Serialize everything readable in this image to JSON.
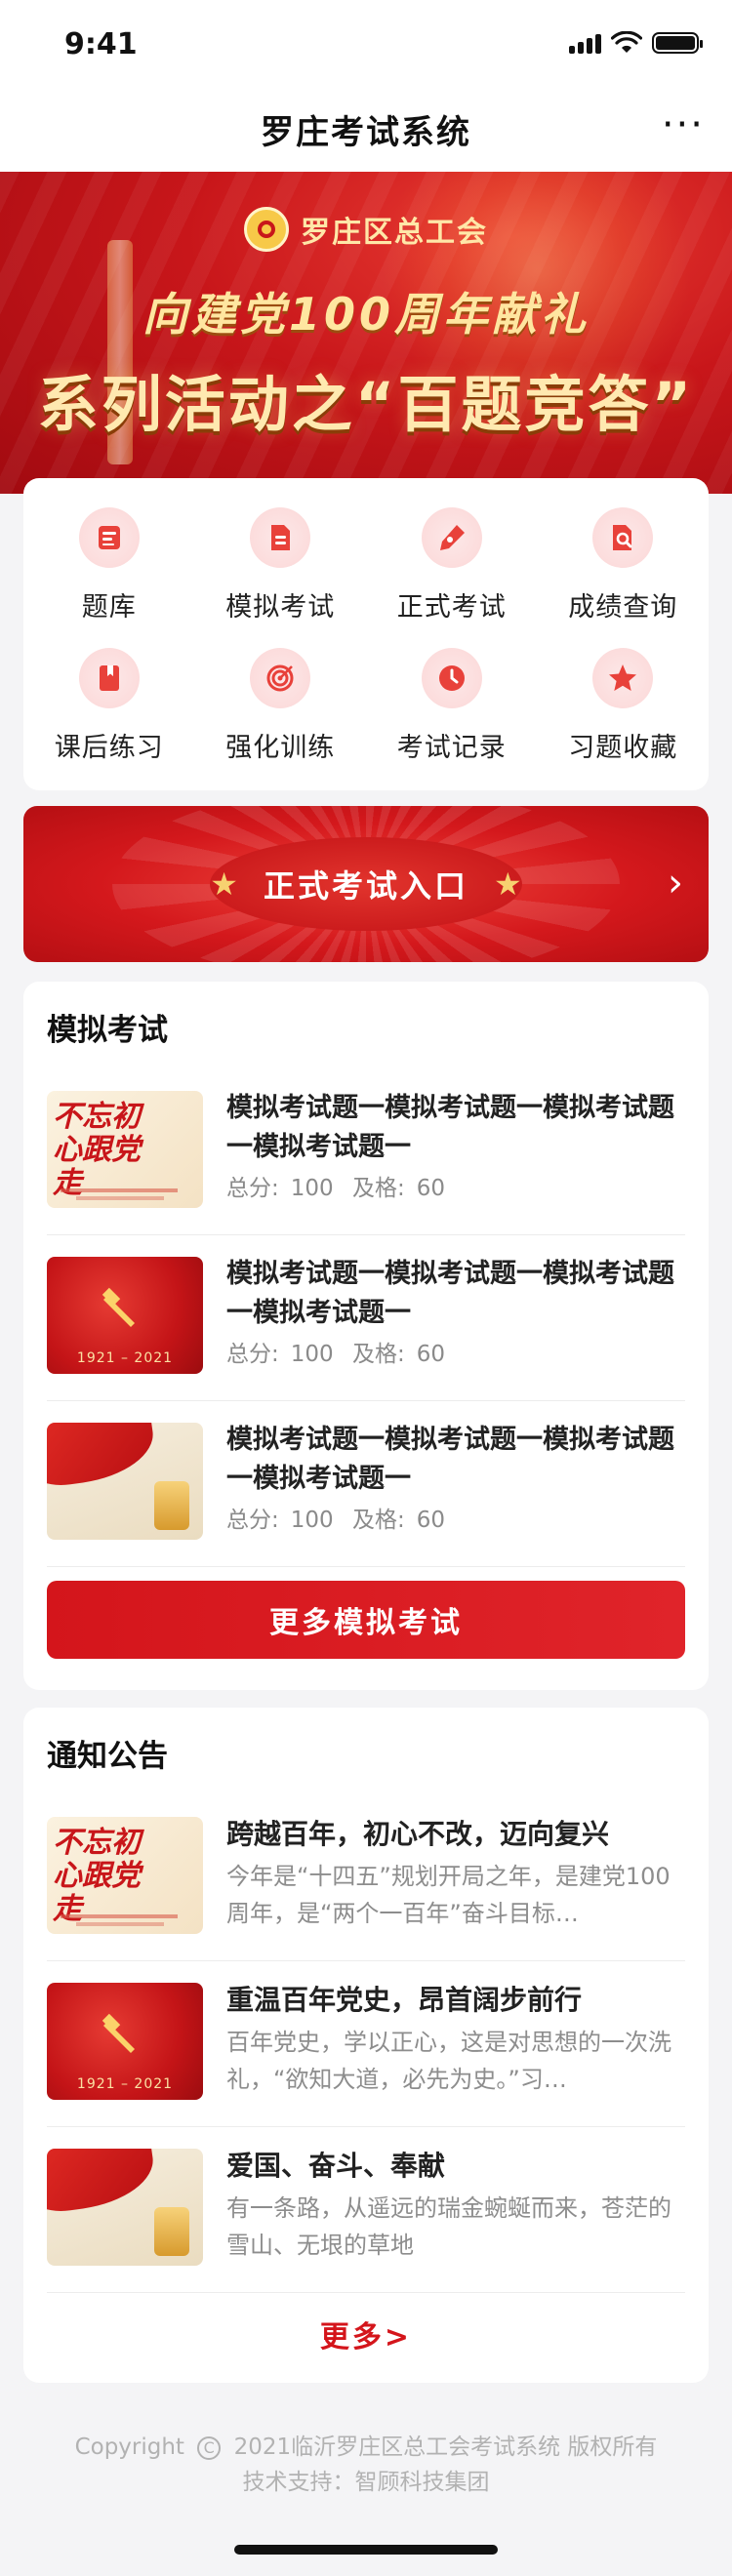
{
  "status_bar": {
    "time": "9:41"
  },
  "nav": {
    "title": "罗庄考试系统",
    "more": "···"
  },
  "banner": {
    "org": "罗庄区总工会",
    "slogan_line1": "向建党100周年献礼",
    "slogan_line2": "系列活动之“百题竞答”"
  },
  "menu": {
    "items": [
      {
        "label": "题库",
        "icon": "question-bank-icon"
      },
      {
        "label": "模拟考试",
        "icon": "document-icon"
      },
      {
        "label": "正式考试",
        "icon": "pen-icon"
      },
      {
        "label": "成绩查询",
        "icon": "search-file-icon"
      },
      {
        "label": "课后练习",
        "icon": "book-icon"
      },
      {
        "label": "强化训练",
        "icon": "target-icon"
      },
      {
        "label": "考试记录",
        "icon": "clock-icon"
      },
      {
        "label": "习题收藏",
        "icon": "star-icon"
      }
    ]
  },
  "entry": {
    "label": "正式考试入口"
  },
  "mock": {
    "title": "模拟考试",
    "items": [
      {
        "title": "模拟考试题一模拟考试题一模拟考试题一模拟考试题一",
        "total_label": "总分:",
        "total": "100",
        "pass_label": "及格:",
        "pass": "60",
        "thumb_text": "不忘初心跟党走"
      },
      {
        "title": "模拟考试题一模拟考试题一模拟考试题一模拟考试题一",
        "total_label": "总分:",
        "total": "100",
        "pass_label": "及格:",
        "pass": "60",
        "thumb_text": "1921 – 2021"
      },
      {
        "title": "模拟考试题一模拟考试题一模拟考试题一模拟考试题一",
        "total_label": "总分:",
        "total": "100",
        "pass_label": "及格:",
        "pass": "60",
        "thumb_text": ""
      }
    ],
    "more_button": "更多模拟考试"
  },
  "notice": {
    "title": "通知公告",
    "items": [
      {
        "title": "跨越百年，初心不改，迈向复兴",
        "desc": "今年是“十四五”规划开局之年，是建党100周年，是“两个一百年”奋斗目标…",
        "thumb_text": "不忘初心跟党走"
      },
      {
        "title": "重温百年党史，昂首阔步前行",
        "desc": "百年党史，学以正心，这是对思想的一次洗礼，“欲知大道，必先为史。”习…",
        "thumb_text": "1921 – 2021"
      },
      {
        "title": "爱国、奋斗、奉献",
        "desc": "有一条路，从遥远的瑞金蜿蜒而来，苍茫的雪山、无垠的草地",
        "thumb_text": ""
      }
    ],
    "more_link": "更多>"
  },
  "footer": {
    "copyright_prefix": "Copyright",
    "copyright_symbol": "C",
    "copyright_text": "2021临沂罗庄区总工会考试系统 版权所有",
    "support": "技术支持：智顾科技集团"
  },
  "colors": {
    "primary_red": "#d4151b",
    "gold": "#f7d170"
  }
}
